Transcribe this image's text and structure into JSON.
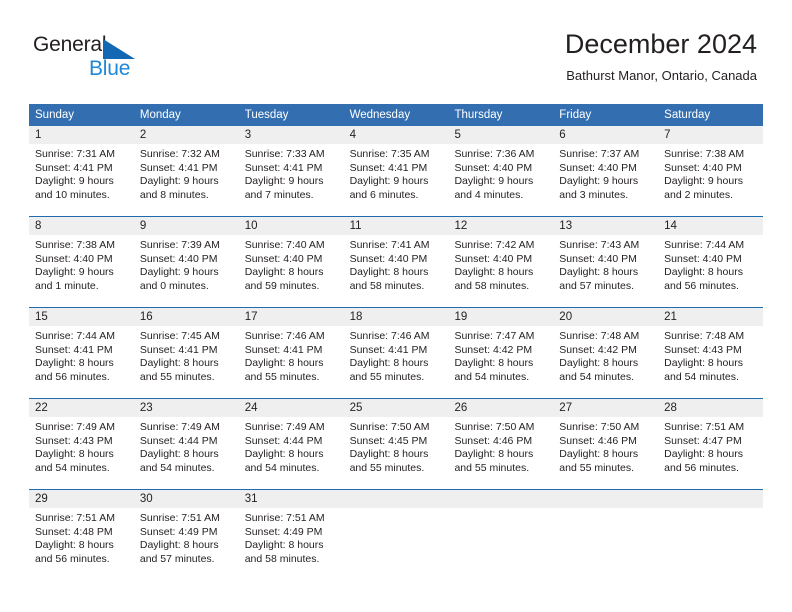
{
  "brand": {
    "name_part1": "General",
    "name_part2": "Blue",
    "triangle_icon": "triangle-icon",
    "accent_dark_blue": "#1268b3",
    "accent_light_blue": "#1f87d8"
  },
  "header": {
    "title": "December 2024",
    "subtitle": "Bathurst Manor, Ontario, Canada"
  },
  "theme": {
    "header_row_bg": "#336fb0",
    "header_row_text": "#ffffff",
    "daynum_band_bg": "#efefef",
    "week_separator": "#1f6bad",
    "body_text": "#231f20"
  },
  "calendar": {
    "weekdays": [
      "Sunday",
      "Monday",
      "Tuesday",
      "Wednesday",
      "Thursday",
      "Friday",
      "Saturday"
    ],
    "weeks": [
      {
        "days": [
          {
            "num": "1",
            "sunrise": "Sunrise: 7:31 AM",
            "sunset": "Sunset: 4:41 PM",
            "daylight_line1": "Daylight: 9 hours",
            "daylight_line2": "and 10 minutes."
          },
          {
            "num": "2",
            "sunrise": "Sunrise: 7:32 AM",
            "sunset": "Sunset: 4:41 PM",
            "daylight_line1": "Daylight: 9 hours",
            "daylight_line2": "and 8 minutes."
          },
          {
            "num": "3",
            "sunrise": "Sunrise: 7:33 AM",
            "sunset": "Sunset: 4:41 PM",
            "daylight_line1": "Daylight: 9 hours",
            "daylight_line2": "and 7 minutes."
          },
          {
            "num": "4",
            "sunrise": "Sunrise: 7:35 AM",
            "sunset": "Sunset: 4:41 PM",
            "daylight_line1": "Daylight: 9 hours",
            "daylight_line2": "and 6 minutes."
          },
          {
            "num": "5",
            "sunrise": "Sunrise: 7:36 AM",
            "sunset": "Sunset: 4:40 PM",
            "daylight_line1": "Daylight: 9 hours",
            "daylight_line2": "and 4 minutes."
          },
          {
            "num": "6",
            "sunrise": "Sunrise: 7:37 AM",
            "sunset": "Sunset: 4:40 PM",
            "daylight_line1": "Daylight: 9 hours",
            "daylight_line2": "and 3 minutes."
          },
          {
            "num": "7",
            "sunrise": "Sunrise: 7:38 AM",
            "sunset": "Sunset: 4:40 PM",
            "daylight_line1": "Daylight: 9 hours",
            "daylight_line2": "and 2 minutes."
          }
        ]
      },
      {
        "days": [
          {
            "num": "8",
            "sunrise": "Sunrise: 7:38 AM",
            "sunset": "Sunset: 4:40 PM",
            "daylight_line1": "Daylight: 9 hours",
            "daylight_line2": "and 1 minute."
          },
          {
            "num": "9",
            "sunrise": "Sunrise: 7:39 AM",
            "sunset": "Sunset: 4:40 PM",
            "daylight_line1": "Daylight: 9 hours",
            "daylight_line2": "and 0 minutes."
          },
          {
            "num": "10",
            "sunrise": "Sunrise: 7:40 AM",
            "sunset": "Sunset: 4:40 PM",
            "daylight_line1": "Daylight: 8 hours",
            "daylight_line2": "and 59 minutes."
          },
          {
            "num": "11",
            "sunrise": "Sunrise: 7:41 AM",
            "sunset": "Sunset: 4:40 PM",
            "daylight_line1": "Daylight: 8 hours",
            "daylight_line2": "and 58 minutes."
          },
          {
            "num": "12",
            "sunrise": "Sunrise: 7:42 AM",
            "sunset": "Sunset: 4:40 PM",
            "daylight_line1": "Daylight: 8 hours",
            "daylight_line2": "and 58 minutes."
          },
          {
            "num": "13",
            "sunrise": "Sunrise: 7:43 AM",
            "sunset": "Sunset: 4:40 PM",
            "daylight_line1": "Daylight: 8 hours",
            "daylight_line2": "and 57 minutes."
          },
          {
            "num": "14",
            "sunrise": "Sunrise: 7:44 AM",
            "sunset": "Sunset: 4:40 PM",
            "daylight_line1": "Daylight: 8 hours",
            "daylight_line2": "and 56 minutes."
          }
        ]
      },
      {
        "days": [
          {
            "num": "15",
            "sunrise": "Sunrise: 7:44 AM",
            "sunset": "Sunset: 4:41 PM",
            "daylight_line1": "Daylight: 8 hours",
            "daylight_line2": "and 56 minutes."
          },
          {
            "num": "16",
            "sunrise": "Sunrise: 7:45 AM",
            "sunset": "Sunset: 4:41 PM",
            "daylight_line1": "Daylight: 8 hours",
            "daylight_line2": "and 55 minutes."
          },
          {
            "num": "17",
            "sunrise": "Sunrise: 7:46 AM",
            "sunset": "Sunset: 4:41 PM",
            "daylight_line1": "Daylight: 8 hours",
            "daylight_line2": "and 55 minutes."
          },
          {
            "num": "18",
            "sunrise": "Sunrise: 7:46 AM",
            "sunset": "Sunset: 4:41 PM",
            "daylight_line1": "Daylight: 8 hours",
            "daylight_line2": "and 55 minutes."
          },
          {
            "num": "19",
            "sunrise": "Sunrise: 7:47 AM",
            "sunset": "Sunset: 4:42 PM",
            "daylight_line1": "Daylight: 8 hours",
            "daylight_line2": "and 54 minutes."
          },
          {
            "num": "20",
            "sunrise": "Sunrise: 7:48 AM",
            "sunset": "Sunset: 4:42 PM",
            "daylight_line1": "Daylight: 8 hours",
            "daylight_line2": "and 54 minutes."
          },
          {
            "num": "21",
            "sunrise": "Sunrise: 7:48 AM",
            "sunset": "Sunset: 4:43 PM",
            "daylight_line1": "Daylight: 8 hours",
            "daylight_line2": "and 54 minutes."
          }
        ]
      },
      {
        "days": [
          {
            "num": "22",
            "sunrise": "Sunrise: 7:49 AM",
            "sunset": "Sunset: 4:43 PM",
            "daylight_line1": "Daylight: 8 hours",
            "daylight_line2": "and 54 minutes."
          },
          {
            "num": "23",
            "sunrise": "Sunrise: 7:49 AM",
            "sunset": "Sunset: 4:44 PM",
            "daylight_line1": "Daylight: 8 hours",
            "daylight_line2": "and 54 minutes."
          },
          {
            "num": "24",
            "sunrise": "Sunrise: 7:49 AM",
            "sunset": "Sunset: 4:44 PM",
            "daylight_line1": "Daylight: 8 hours",
            "daylight_line2": "and 54 minutes."
          },
          {
            "num": "25",
            "sunrise": "Sunrise: 7:50 AM",
            "sunset": "Sunset: 4:45 PM",
            "daylight_line1": "Daylight: 8 hours",
            "daylight_line2": "and 55 minutes."
          },
          {
            "num": "26",
            "sunrise": "Sunrise: 7:50 AM",
            "sunset": "Sunset: 4:46 PM",
            "daylight_line1": "Daylight: 8 hours",
            "daylight_line2": "and 55 minutes."
          },
          {
            "num": "27",
            "sunrise": "Sunrise: 7:50 AM",
            "sunset": "Sunset: 4:46 PM",
            "daylight_line1": "Daylight: 8 hours",
            "daylight_line2": "and 55 minutes."
          },
          {
            "num": "28",
            "sunrise": "Sunrise: 7:51 AM",
            "sunset": "Sunset: 4:47 PM",
            "daylight_line1": "Daylight: 8 hours",
            "daylight_line2": "and 56 minutes."
          }
        ]
      },
      {
        "days": [
          {
            "num": "29",
            "sunrise": "Sunrise: 7:51 AM",
            "sunset": "Sunset: 4:48 PM",
            "daylight_line1": "Daylight: 8 hours",
            "daylight_line2": "and 56 minutes."
          },
          {
            "num": "30",
            "sunrise": "Sunrise: 7:51 AM",
            "sunset": "Sunset: 4:49 PM",
            "daylight_line1": "Daylight: 8 hours",
            "daylight_line2": "and 57 minutes."
          },
          {
            "num": "31",
            "sunrise": "Sunrise: 7:51 AM",
            "sunset": "Sunset: 4:49 PM",
            "daylight_line1": "Daylight: 8 hours",
            "daylight_line2": "and 58 minutes."
          },
          {
            "num": "",
            "sunrise": "",
            "sunset": "",
            "daylight_line1": "",
            "daylight_line2": ""
          },
          {
            "num": "",
            "sunrise": "",
            "sunset": "",
            "daylight_line1": "",
            "daylight_line2": ""
          },
          {
            "num": "",
            "sunrise": "",
            "sunset": "",
            "daylight_line1": "",
            "daylight_line2": ""
          },
          {
            "num": "",
            "sunrise": "",
            "sunset": "",
            "daylight_line1": "",
            "daylight_line2": ""
          }
        ]
      }
    ]
  }
}
